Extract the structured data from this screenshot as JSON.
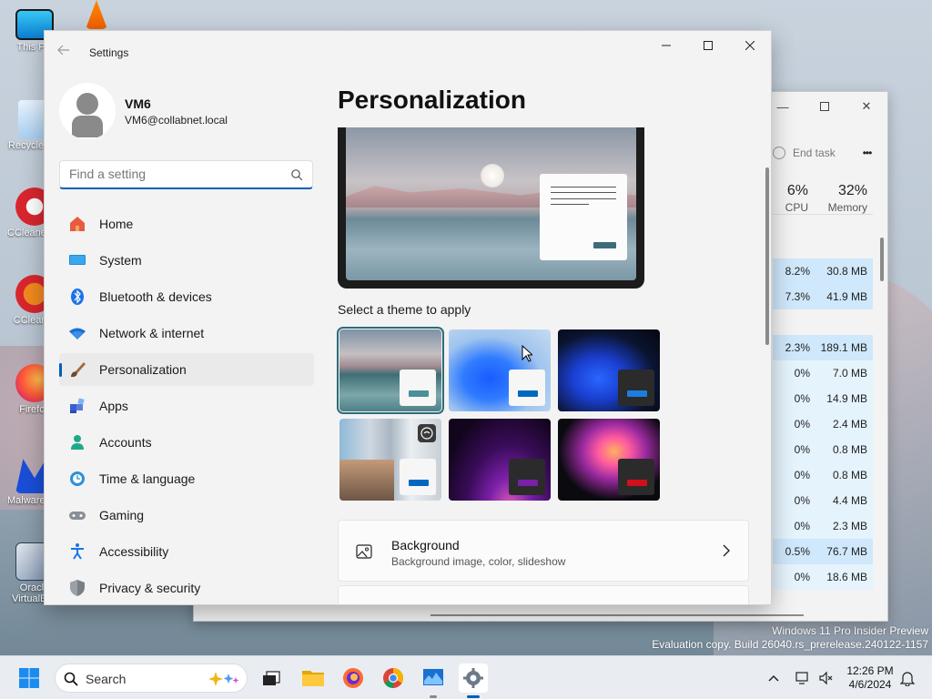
{
  "desktop": {
    "icons": [
      {
        "label": "This PC"
      },
      {
        "label": "Recycle Bin"
      },
      {
        "label": "CCleaner Browser"
      },
      {
        "label": "CCleaner"
      },
      {
        "label": "Firefox"
      },
      {
        "label": "Malwarebytes"
      },
      {
        "label": "Oracle VirtualBox"
      }
    ],
    "watermark": {
      "line1": "Windows 11 Pro Insider Preview",
      "line2": "Evaluation copy. Build 26040.rs_prerelease.240122-1157"
    }
  },
  "taskmgr": {
    "end_task": "End task",
    "more": "•••",
    "cpu_percent": "6%",
    "cpu_label": "CPU",
    "mem_percent": "32%",
    "mem_label": "Memory",
    "rows": [
      {
        "cpu": "8.2%",
        "mem": "30.8 MB",
        "hl": "hl"
      },
      {
        "cpu": "7.3%",
        "mem": "41.9 MB",
        "hl": "hl"
      },
      {
        "cpu": "",
        "mem": "",
        "hl": ""
      },
      {
        "cpu": "2.3%",
        "mem": "189.1 MB",
        "hl": "hl"
      },
      {
        "cpu": "0%",
        "mem": "7.0 MB",
        "hl": "lt"
      },
      {
        "cpu": "0%",
        "mem": "14.9 MB",
        "hl": "lt"
      },
      {
        "cpu": "0%",
        "mem": "2.4 MB",
        "hl": "lt"
      },
      {
        "cpu": "0%",
        "mem": "0.8 MB",
        "hl": "lt"
      },
      {
        "cpu": "0%",
        "mem": "0.8 MB",
        "hl": "lt"
      },
      {
        "cpu": "0%",
        "mem": "4.4 MB",
        "hl": "lt"
      },
      {
        "cpu": "0%",
        "mem": "2.3 MB",
        "hl": "lt"
      },
      {
        "cpu": "0.5%",
        "mem": "76.7 MB",
        "hl": "hl"
      },
      {
        "cpu": "0%",
        "mem": "18.6 MB",
        "hl": "lt"
      }
    ]
  },
  "settings": {
    "window_title": "Settings",
    "profile": {
      "name": "VM6",
      "email": "VM6@collabnet.local"
    },
    "search": {
      "placeholder": "Find a setting",
      "value": ""
    },
    "nav": [
      {
        "label": "Home",
        "icon": "home-icon"
      },
      {
        "label": "System",
        "icon": "system-icon"
      },
      {
        "label": "Bluetooth & devices",
        "icon": "bluetooth-icon"
      },
      {
        "label": "Network & internet",
        "icon": "wifi-icon"
      },
      {
        "label": "Personalization",
        "icon": "brush-icon",
        "active": true
      },
      {
        "label": "Apps",
        "icon": "apps-icon"
      },
      {
        "label": "Accounts",
        "icon": "accounts-icon"
      },
      {
        "label": "Time & language",
        "icon": "clock-globe-icon"
      },
      {
        "label": "Gaming",
        "icon": "gamepad-icon"
      },
      {
        "label": "Accessibility",
        "icon": "accessibility-icon"
      },
      {
        "label": "Privacy & security",
        "icon": "shield-icon"
      }
    ],
    "page_title": "Personalization",
    "themes_label": "Select a theme to apply",
    "themes": [
      {
        "id": "lake",
        "selected": true
      },
      {
        "id": "bloom-light"
      },
      {
        "id": "bloom-dark"
      },
      {
        "id": "spotlight"
      },
      {
        "id": "glow"
      },
      {
        "id": "flow"
      }
    ],
    "background": {
      "title": "Background",
      "subtitle": "Background image, color, slideshow"
    }
  },
  "taskbar": {
    "search_label": "Search",
    "time": "12:26 PM",
    "date": "4/6/2024"
  },
  "colors": {
    "accent": "#005fb8"
  }
}
